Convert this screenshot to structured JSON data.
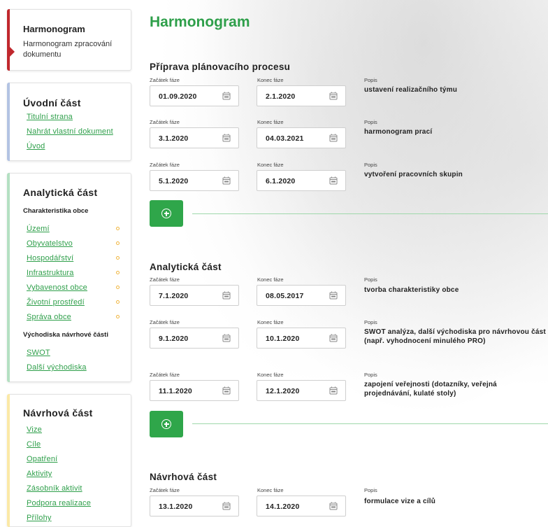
{
  "page": {
    "title": "Harmonogram"
  },
  "sidebar": {
    "harmonogram": {
      "title": "Harmonogram",
      "subtitle": "Harmonogram zpracování dokumentu"
    },
    "uvodni": {
      "title": "Úvodní část",
      "items": [
        "Titulní strana",
        "Nahrát vlastní dokument",
        "Úvod"
      ]
    },
    "analyticka": {
      "title": "Analytická část",
      "group1": "Charakteristika obce",
      "items1": [
        "Území",
        "Obyvatelstvo",
        "Hospodářství",
        "Infrastruktura",
        "Vybavenost obce",
        "Životní prostředí",
        "Správa obce"
      ],
      "group2": "Východiska návrhové části",
      "items2": [
        "SWOT",
        "Další východiska"
      ]
    },
    "navrhova": {
      "title": "Návrhová část",
      "items": [
        "Vize",
        "Cíle",
        "Opatření",
        "Aktivity",
        "Zásobník aktivit",
        "Podpora realizace",
        "Přílohy"
      ]
    }
  },
  "labels": {
    "start": "Začátek fáze",
    "end": "Konec fáze",
    "popis": "Popis"
  },
  "sections": [
    {
      "title": "Příprava plánovacího procesu",
      "rows": [
        {
          "start": "01.09.2020",
          "end": "2.1.2020",
          "popis": "ustavení realizačního týmu"
        },
        {
          "start": "3.1.2020",
          "end": "04.03.2021",
          "popis": "harmonogram prací"
        },
        {
          "start": "5.1.2020",
          "end": "6.1.2020",
          "popis": "vytvoření pracovních skupin"
        }
      ]
    },
    {
      "title": "Analytická část",
      "rows": [
        {
          "start": "7.1.2020",
          "end": "08.05.2017",
          "popis": "tvorba charakteristiky obce"
        },
        {
          "start": "9.1.2020",
          "end": "10.1.2020",
          "popis": "SWOT analýza, další východiska pro návrhovou část (např. vyhodnocení minulého PRO)"
        },
        {
          "start": "11.1.2020",
          "end": "12.1.2020",
          "popis": "zapojení veřejnosti (dotazníky, veřejná projednávání, kulaté stoly)"
        }
      ]
    },
    {
      "title": "Návrhová část",
      "rows": [
        {
          "start": "13.1.2020",
          "end": "14.1.2020",
          "popis": "formulace vize a cílů"
        }
      ]
    }
  ],
  "colors": {
    "accent": "#2e9f4a",
    "button": "#2fa64a",
    "bar_harmonogram": "#c0282d",
    "bar_uvodni": "#b3c3e3",
    "bar_analyticka": "#b4e0c2",
    "bar_navrhova": "#fbe9a6",
    "status_dot": "#f0b640"
  },
  "icons": {
    "calendar": "calendar-icon",
    "add": "plus-circle-icon"
  }
}
